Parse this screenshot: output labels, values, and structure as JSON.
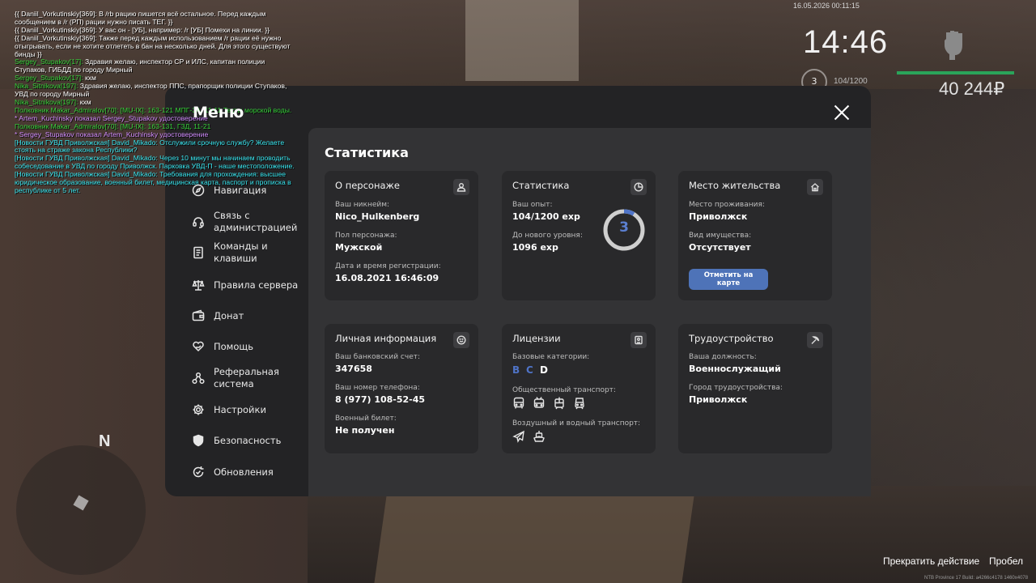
{
  "chat": [
    {
      "color": "white",
      "text": "{{ Daniil_Vorkutinskiy[369]: В /rb рацию пишется всё остальное. Перед каждым сообщением в /r (РП) рации нужно писать ТЕГ. }}"
    },
    {
      "color": "white",
      "text": "{{ Daniil_Vorkutinskiy[369]: У вас он - [УБ], например: /r [УБ] Помехи на линии. }}"
    },
    {
      "color": "white",
      "text": "{{ Daniil_Vorkutinskiy[369]: Также перед каждым использованием /r рации её нужно отыгрывать, если не хотите отлететь в бан на несколько дней. Для этого существуют бинды }}"
    },
    {
      "color": "green",
      "name": "Sergey_Stupakov[17]:",
      "text": " Здравия желаю, инспектор СР и ИЛС, капитан полиции Ступаков, ГИБДД по городу Мирный"
    },
    {
      "color": "green",
      "name": "Sergey_Stupakov[17]:",
      "text": " кхм"
    },
    {
      "color": "green",
      "name": "Nika_Sitnikova[197]:",
      "text": " Здравия желаю, инспектор ППС, прапорщик полиции Ступаков, УВД по городу Мирный"
    },
    {
      "color": "green",
      "name": "Nika_Sitnikova[197]:",
      "text": " кхм"
    },
    {
      "color": "green",
      "text": "Полковник Makar_Admiralov[70]: [MU-IX]: 163-121 МПГ-3А, 11-11 Тесты морской воды."
    },
    {
      "color": "purple",
      "text": "* Artem_Kuchinsky показал Sergey_Stupakov удостоверение"
    },
    {
      "color": "green",
      "text": "Полковник Makar_Admiralov[70]: [MU-IX]: 163-131, ГЗД, 11-21"
    },
    {
      "color": "purple",
      "text": "* Sergey_Stupakov показал Artem_Kuchinsky удостоверение"
    },
    {
      "color": "cyan",
      "text": "[Новости ГУВД Приволжская] David_Mikado: Отслужили срочную службу? Желаете стоять на страже закона Республики?"
    },
    {
      "color": "cyan",
      "text": "[Новости ГУВД Приволжская] David_Mikado: Через 10 минут мы начинаем проводить собеседование в УВД по городу Приволжск. Парковка УВД-П - наше местоположение."
    },
    {
      "color": "cyan",
      "text": "[Новости ГУВД Приволжская] David_Mikado: Требования для прохождения: высшее юридическое образование, военный билет, медицинская карта, паспорт и прописка в республике от 5 лет."
    }
  ],
  "hud": {
    "date": "16.05.2026 00:11:15",
    "time": "14:46",
    "level": "3",
    "exp": "104/1200",
    "money": "40 244₽"
  },
  "compass": {
    "north": "N"
  },
  "hints": {
    "cancel": "Прекратить действие",
    "key": "Пробел"
  },
  "build": "NTB Province 17 Build: a4266c4178 1460x4078",
  "menu": {
    "title": "Меню",
    "nav": [
      {
        "label": "Навигация",
        "icon": "compass-icon"
      },
      {
        "label": "Связь с администрацией",
        "icon": "headset-icon"
      },
      {
        "label": "Команды и клавиши",
        "icon": "document-icon"
      },
      {
        "label": "Правила сервера",
        "icon": "scales-icon"
      },
      {
        "label": "Донат",
        "icon": "wallet-icon"
      },
      {
        "label": "Помощь",
        "icon": "heart-hand-icon"
      },
      {
        "label": "Реферальная система",
        "icon": "referral-icon"
      },
      {
        "label": "Настройки",
        "icon": "gear-icon"
      },
      {
        "label": "Безопасность",
        "icon": "shield-icon"
      },
      {
        "label": "Обновления",
        "icon": "update-icon"
      }
    ]
  },
  "stats": {
    "title": "Статистика",
    "character": {
      "title": "О персонаже",
      "nick_label": "Ваш никнейм:",
      "nick": "Nico_Hulkenberg",
      "gender_label": "Пол персонажа:",
      "gender": "Мужской",
      "reg_label": "Дата и время регистрации:",
      "reg": "16.08.2021 16:46:09"
    },
    "statistics": {
      "title": "Статистика",
      "exp_label": "Ваш опыт:",
      "exp": "104/1200 exp",
      "next_label": "До нового уровня:",
      "next": "1096 exp",
      "level": "3",
      "progress": 0.0867
    },
    "residence": {
      "title": "Место жительства",
      "place_label": "Место проживания:",
      "place": "Приволжск",
      "property_label": "Вид имущества:",
      "property": "Отсутствует",
      "map_button": "Отметить на карте"
    },
    "personal": {
      "title": "Личная информация",
      "bank_label": "Ваш банковский счет:",
      "bank": "347658",
      "phone_label": "Ваш номер телефона:",
      "phone": "8 (977) 108-52-45",
      "military_label": "Военный билет:",
      "military": "Не получен"
    },
    "licenses": {
      "title": "Лицензии",
      "basic_label": "Базовые категории:",
      "categories": [
        {
          "letter": "B",
          "color": "#4f74c8"
        },
        {
          "letter": "C",
          "color": "#4f74c8"
        },
        {
          "letter": "D",
          "color": "#ffffff"
        }
      ],
      "public_label": "Общественный транспорт:",
      "air_label": "Воздушный и водный транспорт:"
    },
    "employment": {
      "title": "Трудоустройство",
      "position_label": "Ваша должность:",
      "position": "Военнослужащий",
      "city_label": "Город трудоустройства:",
      "city": "Приволжск"
    }
  }
}
